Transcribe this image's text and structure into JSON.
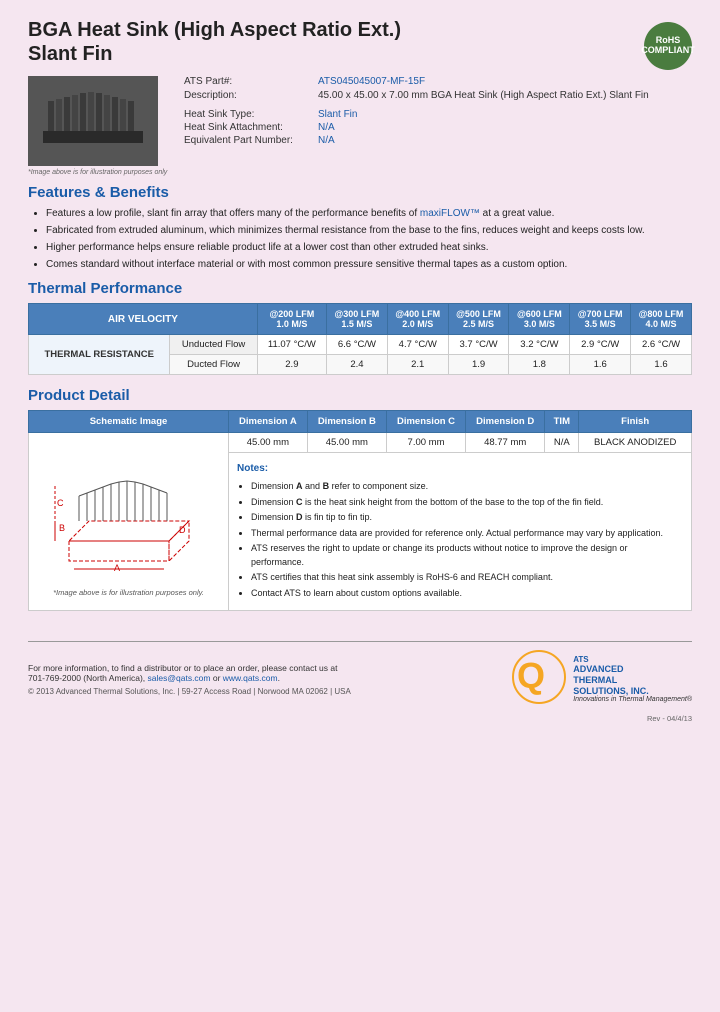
{
  "header": {
    "title_line1": "BGA Heat Sink (High Aspect Ratio Ext.)",
    "title_line2": "Slant Fin",
    "rohs_badge": "RoHS\nCOMPLIANT"
  },
  "specs": {
    "part_label": "ATS Part#:",
    "part_number": "ATS045045007-MF-15F",
    "description_label": "Description:",
    "description_value": "45.00 x 45.00 x 7.00 mm BGA Heat Sink (High Aspect Ratio Ext.) Slant Fin",
    "heat_sink_type_label": "Heat Sink Type:",
    "heat_sink_type_value": "Slant Fin",
    "attachment_label": "Heat Sink Attachment:",
    "attachment_value": "N/A",
    "equiv_part_label": "Equivalent Part Number:",
    "equiv_part_value": "N/A"
  },
  "image_caption": "*Image above is for illustration purposes only",
  "features": {
    "section_title": "Features & Benefits",
    "items": [
      "Features a low profile, slant fin array that offers many of the performance benefits of maxiFLOW™ at a great value.",
      "Fabricated from extruded aluminum, which minimizes thermal resistance from the base to the fins, reduces weight and keeps costs low.",
      "Higher performance helps ensure reliable product life at a lower cost than other extruded heat sinks.",
      "Comes standard without interface material or with most common pressure sensitive thermal tapes as a custom option."
    ]
  },
  "thermal_performance": {
    "section_title": "Thermal Performance",
    "table": {
      "header_col1": "AIR VELOCITY",
      "columns": [
        {
          "label": "@200 LFM",
          "sub": "1.0 M/S"
        },
        {
          "label": "@300 LFM",
          "sub": "1.5 M/S"
        },
        {
          "label": "@400 LFM",
          "sub": "2.0 M/S"
        },
        {
          "label": "@500 LFM",
          "sub": "2.5 M/S"
        },
        {
          "label": "@600 LFM",
          "sub": "3.0 M/S"
        },
        {
          "label": "@700 LFM",
          "sub": "3.5 M/S"
        },
        {
          "label": "@800 LFM",
          "sub": "4.0 M/S"
        }
      ],
      "row_label": "THERMAL RESISTANCE",
      "unducted_label": "Unducted Flow",
      "unducted_values": [
        "11.07 °C/W",
        "6.6 °C/W",
        "4.7 °C/W",
        "3.7 °C/W",
        "3.2 °C/W",
        "2.9 °C/W",
        "2.6 °C/W"
      ],
      "ducted_label": "Ducted Flow",
      "ducted_values": [
        "2.9",
        "2.4",
        "2.1",
        "1.9",
        "1.8",
        "1.6",
        "1.6"
      ]
    }
  },
  "product_detail": {
    "section_title": "Product Detail",
    "table_headers": [
      "Schematic Image",
      "Dimension A",
      "Dimension B",
      "Dimension C",
      "Dimension D",
      "TIM",
      "Finish"
    ],
    "dimensions": {
      "A": "45.00 mm",
      "B": "45.00 mm",
      "C": "7.00 mm",
      "D": "48.77 mm",
      "TIM": "N/A",
      "Finish": "BLACK ANODIZED"
    },
    "notes_title": "Notes:",
    "notes": [
      "Dimension A and B refer to component size.",
      "Dimension C is the heat sink height from the bottom of the base to the top of the fin field.",
      "Dimension D is fin tip to fin tip.",
      "Thermal performance data are provided for reference only. Actual performance may vary by application.",
      "ATS reserves the right to update or change its products without notice to improve the design or performance.",
      "ATS certifies that this heat sink assembly is RoHS-6 and REACH compliant.",
      "Contact ATS to learn about custom options available."
    ],
    "schematic_caption": "*Image above is for illustration purposes only."
  },
  "footer": {
    "contact_text": "For more information, to find a distributor or to place an order, please contact us at\n701-769-2000 (North America),",
    "email": "sales@qats.com",
    "email_connector": " or ",
    "website": "www.qats.com",
    "website_suffix": ".",
    "copyright": "© 2013 Advanced Thermal Solutions, Inc. | 59-27 Access Road | Norwood MA  02062 | USA",
    "ats_name_line1": "ADVANCED",
    "ats_name_line2": "THERMAL",
    "ats_name_line3": "SOLUTIONS, INC.",
    "ats_tagline": "Innovations in Thermal Management®",
    "rev": "Rev - 04/4/13"
  }
}
